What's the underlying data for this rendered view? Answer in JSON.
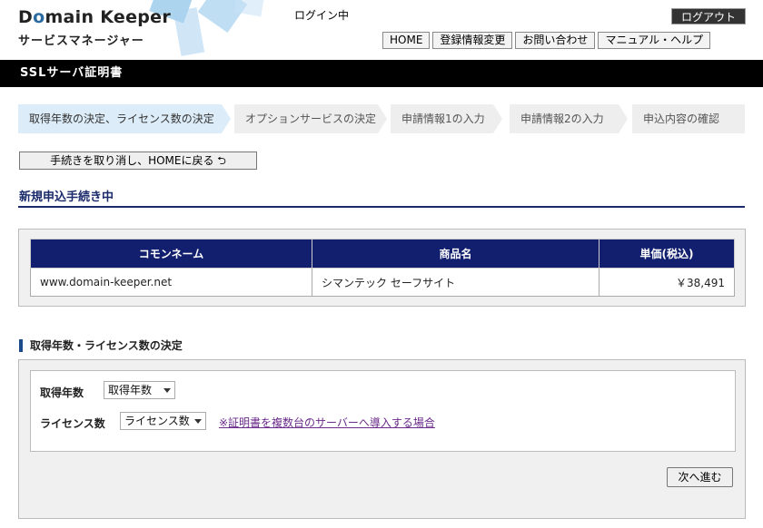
{
  "header": {
    "logo_title_pre": "D",
    "logo_title_o": "o",
    "logo_title_post": "main Keeper",
    "logo_subtitle": "サービスマネージャー",
    "login_status": "ログイン中",
    "logout_label": "ログアウト",
    "nav": [
      "HOME",
      "登録情報変更",
      "お問い合わせ",
      "マニュアル・ヘルプ"
    ]
  },
  "title_bar": "SSLサーバ証明書",
  "steps": [
    {
      "label": "取得年数の決定、ライセンス数の決定",
      "active": true
    },
    {
      "label": "オプションサービスの決定",
      "active": false
    },
    {
      "label": "申請情報1の入力",
      "active": false
    },
    {
      "label": "申請情報2の入力",
      "active": false
    },
    {
      "label": "申込内容の確認",
      "active": false
    }
  ],
  "cancel_button": "手続きを取り消し、HOMEに戻る ⮌",
  "section_heading": "新規申込手続き中",
  "product_table": {
    "headers": [
      "コモンネーム",
      "商品名",
      "単価(税込)"
    ],
    "row": [
      "www.domain-keeper.net",
      "シマンテック セーフサイト",
      "￥38,491"
    ]
  },
  "license_section": {
    "heading": "取得年数・ライセンス数の決定",
    "years_label": "取得年数",
    "years_select": "取得年数",
    "license_label": "ライセンス数",
    "license_select": "ライセンス数",
    "multi_server_link": "※証明書を複数台のサーバーへ導入する場合",
    "next_button": "次へ進む"
  },
  "colors": {
    "title_bar": "#000000",
    "table_header": "#111f6e",
    "active_step": "#dcecf8",
    "link": "#6a2a8a"
  }
}
